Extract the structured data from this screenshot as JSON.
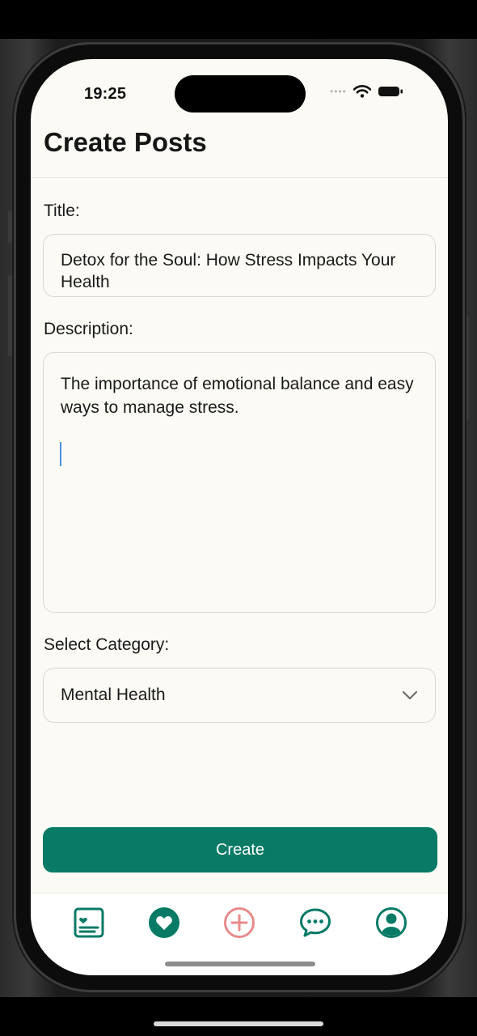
{
  "status_bar": {
    "time": "19:25"
  },
  "header": {
    "title": "Create Posts"
  },
  "form": {
    "title_label": "Title:",
    "title_value": "Detox for the Soul: How Stress Impacts Your Health",
    "description_label": "Description:",
    "description_value": "The importance of emotional balance and easy ways to manage stress.",
    "category_label": "Select Category:",
    "category_selected": "Mental Health",
    "submit_label": "Create"
  },
  "tab_bar": {
    "tabs": [
      {
        "icon": "posts-list-icon",
        "color": "#087a66"
      },
      {
        "icon": "heart-circle-icon",
        "color": "#087a66"
      },
      {
        "icon": "plus-circle-icon",
        "color": "#e88a8a"
      },
      {
        "icon": "chat-bubble-icon",
        "color": "#087a66"
      },
      {
        "icon": "profile-icon",
        "color": "#087a66"
      }
    ]
  },
  "colors": {
    "accent": "#087a66",
    "background": "#fbfaf4",
    "active_tab": "#e88a8a"
  }
}
